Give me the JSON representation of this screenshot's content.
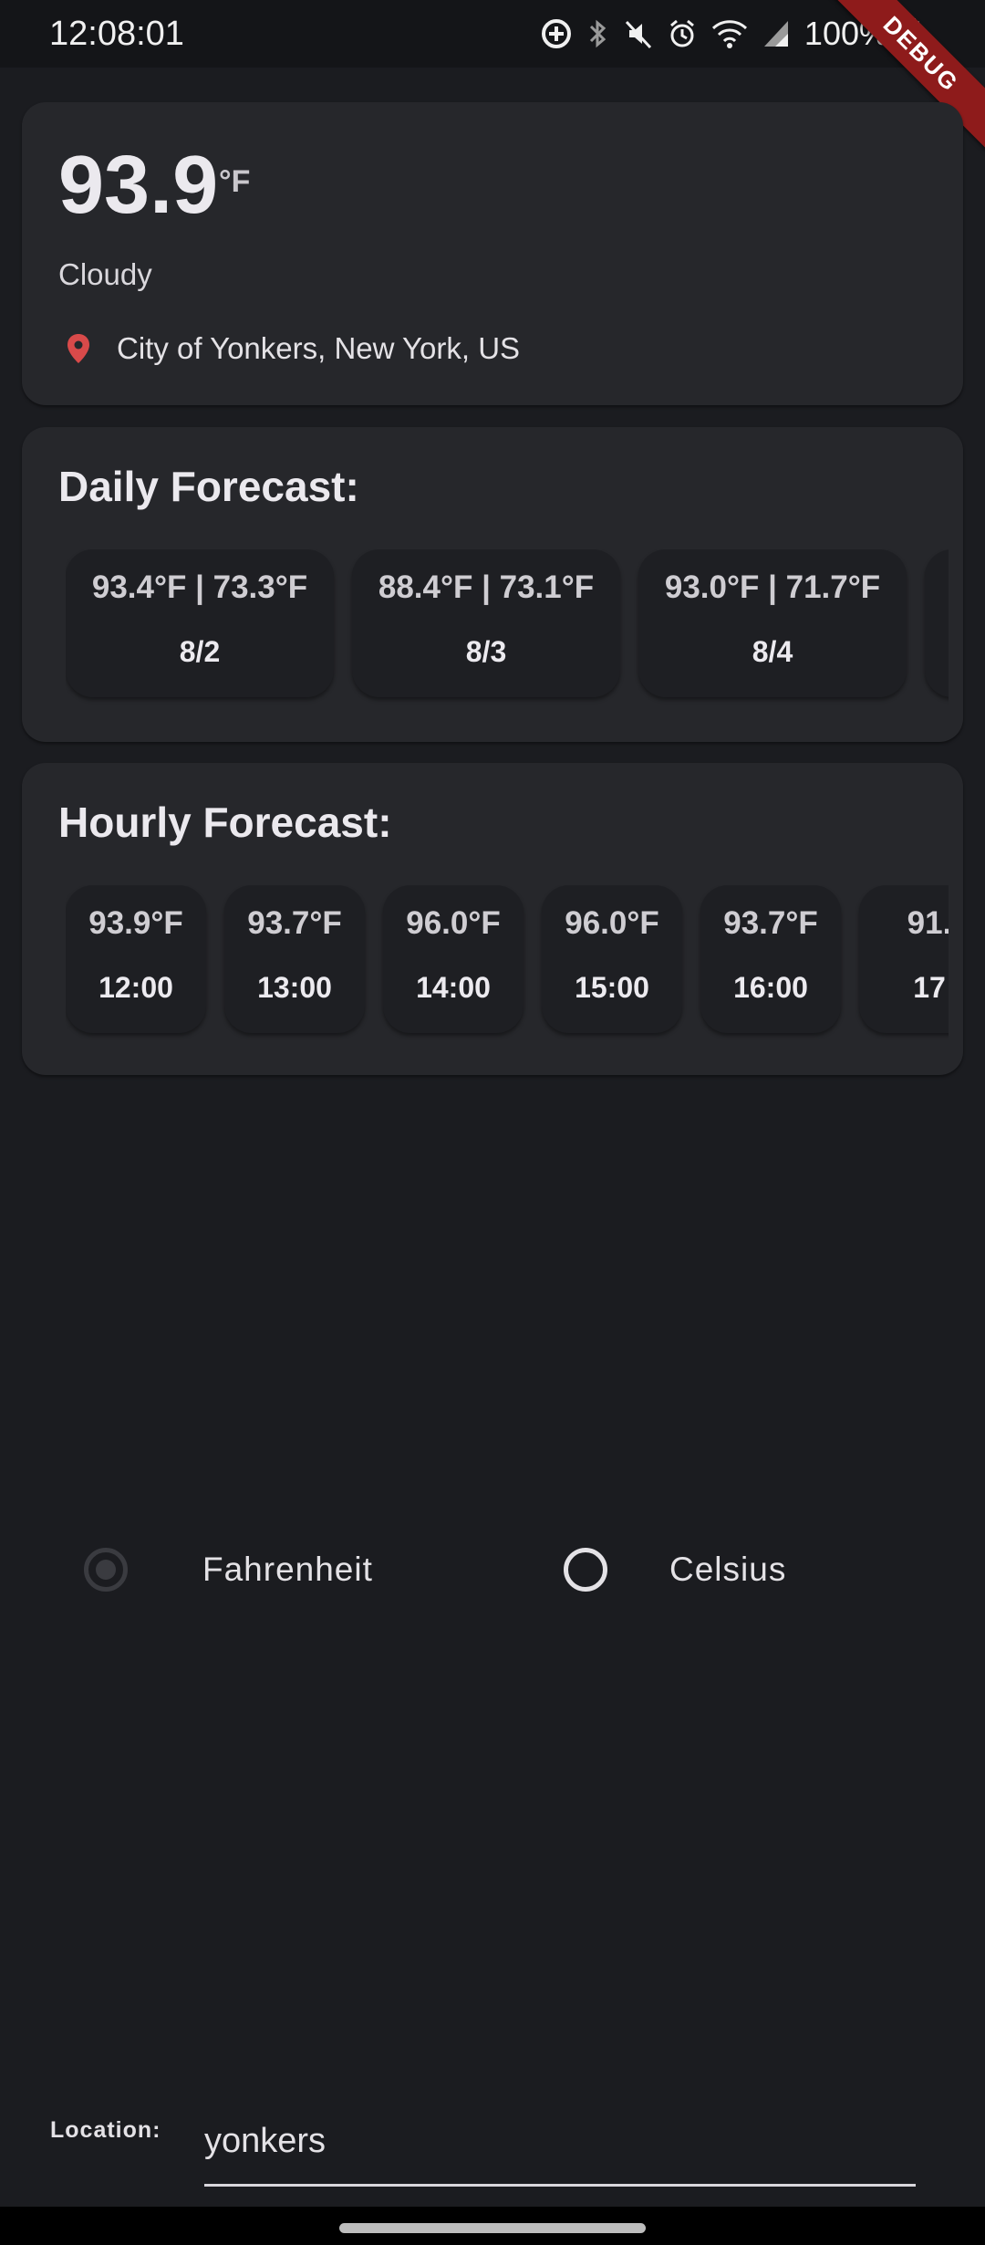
{
  "status_bar": {
    "time": "12:08:01",
    "battery": "100%",
    "icons": [
      "data-saver-icon",
      "bluetooth-icon",
      "mute-icon",
      "alarm-icon",
      "wifi-icon",
      "signal-icon",
      "battery-icon"
    ],
    "debug_label": "DEBUG"
  },
  "current": {
    "temperature": "93.9",
    "unit": "°F",
    "condition": "Cloudy",
    "location": "City of Yonkers, New York, US"
  },
  "daily": {
    "title": "Daily Forecast:",
    "items": [
      {
        "temps": "93.4°F | 73.3°F",
        "date": "8/2"
      },
      {
        "temps": "88.4°F | 73.1°F",
        "date": "8/3"
      },
      {
        "temps": "93.0°F | 71.7°F",
        "date": "8/4"
      }
    ]
  },
  "hourly": {
    "title": "Hourly Forecast:",
    "items": [
      {
        "temp": "93.9°F",
        "time": "12:00"
      },
      {
        "temp": "93.7°F",
        "time": "13:00"
      },
      {
        "temp": "96.0°F",
        "time": "14:00"
      },
      {
        "temp": "96.0°F",
        "time": "15:00"
      },
      {
        "temp": "93.7°F",
        "time": "16:00"
      },
      {
        "temp": "91.",
        "time": "17"
      }
    ]
  },
  "units": {
    "fahrenheit_label": "Fahrenheit",
    "celsius_label": "Celsius",
    "selected": "Fahrenheit"
  },
  "location_input": {
    "label": "Location:",
    "value": "yonkers"
  },
  "colors": {
    "background": "#1b1c20",
    "card": "#26272b",
    "chip": "#1e1f23",
    "pin": "#d94a4a",
    "debug_ribbon": "#8e1b1b"
  }
}
